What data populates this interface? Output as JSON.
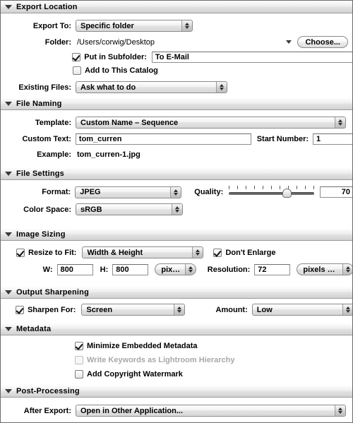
{
  "sections": {
    "export_location": {
      "title": "Export Location",
      "export_to_label": "Export To:",
      "export_to_value": "Specific folder",
      "folder_label": "Folder:",
      "folder_value": "/Users/corwig/Desktop",
      "choose_button": "Choose...",
      "put_in_subfolder_label": "Put in Subfolder:",
      "put_in_subfolder_checked": true,
      "subfolder_value": "To E-Mail",
      "add_to_catalog_label": "Add to This Catalog",
      "add_to_catalog_checked": false,
      "existing_files_label": "Existing Files:",
      "existing_files_value": "Ask what to do"
    },
    "file_naming": {
      "title": "File Naming",
      "template_label": "Template:",
      "template_value": "Custom Name – Sequence",
      "custom_text_label": "Custom Text:",
      "custom_text_value": "tom_curren",
      "start_number_label": "Start Number:",
      "start_number_value": "1",
      "example_label": "Example:",
      "example_value": "tom_curren-1.jpg"
    },
    "file_settings": {
      "title": "File Settings",
      "format_label": "Format:",
      "format_value": "JPEG",
      "quality_label": "Quality:",
      "quality_value": "70",
      "quality_percent": 70,
      "color_space_label": "Color Space:",
      "color_space_value": "sRGB"
    },
    "image_sizing": {
      "title": "Image Sizing",
      "resize_to_fit_label": "Resize to Fit:",
      "resize_to_fit_checked": true,
      "resize_mode_value": "Width & Height",
      "dont_enlarge_label": "Don't Enlarge",
      "dont_enlarge_checked": true,
      "width_label": "W:",
      "width_value": "800",
      "height_label": "H:",
      "height_value": "800",
      "units_value": "pixels",
      "resolution_label": "Resolution:",
      "resolution_value": "72",
      "resolution_units_value": "pixels per inch"
    },
    "output_sharpening": {
      "title": "Output Sharpening",
      "sharpen_for_label": "Sharpen For:",
      "sharpen_for_checked": true,
      "sharpen_for_value": "Screen",
      "amount_label": "Amount:",
      "amount_value": "Low"
    },
    "metadata": {
      "title": "Metadata",
      "minimize_label": "Minimize Embedded Metadata",
      "minimize_checked": true,
      "write_keywords_label": "Write Keywords as Lightroom Hierarchy",
      "write_keywords_checked": false,
      "write_keywords_disabled": true,
      "watermark_label": "Add Copyright Watermark",
      "watermark_checked": false
    },
    "post_processing": {
      "title": "Post-Processing",
      "after_export_label": "After Export:",
      "after_export_value": "Open in Other Application..."
    }
  },
  "icons": {
    "disclosure": "triangle-down",
    "stepper": "up-down-arrows",
    "folder_menu": "caret-down"
  },
  "colors": {
    "header_gradient_top": "#fdfdfd",
    "header_gradient_bottom": "#d2d2d2",
    "border": "#6b6b6b",
    "panel_bg": "#ffffff",
    "disabled_text": "#a8a8a8"
  }
}
